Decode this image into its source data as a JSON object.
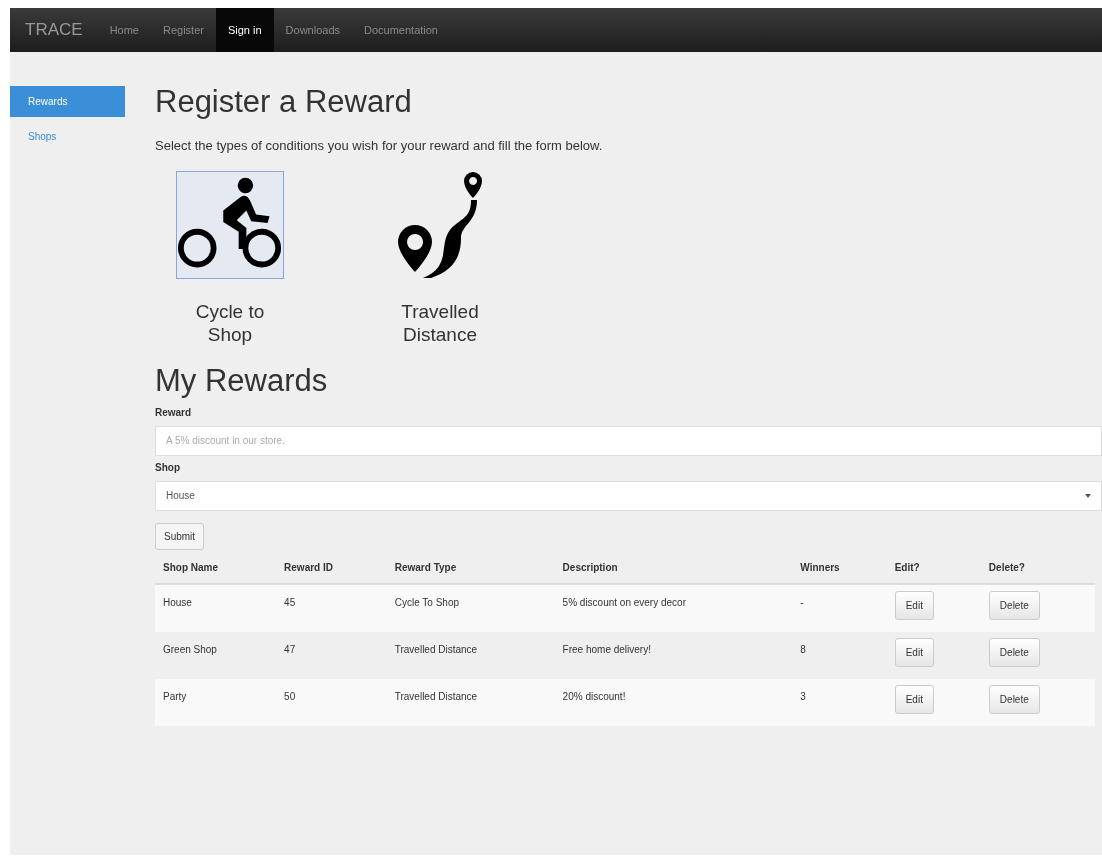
{
  "navbar": {
    "brand": "TRACE",
    "items": [
      {
        "label": "Home",
        "selected": false
      },
      {
        "label": "Register",
        "selected": false
      },
      {
        "label": "Sign in",
        "selected": true
      },
      {
        "label": "Downloads",
        "selected": false
      },
      {
        "label": "Documentation",
        "selected": false
      }
    ]
  },
  "sidebar": {
    "items": [
      {
        "label": "Rewards",
        "selected": true
      },
      {
        "label": "Shops",
        "selected": false
      }
    ]
  },
  "heading": "Register a Reward",
  "intro": "Select the types of conditions you wish for your reward and fill the form below.",
  "conditions": [
    {
      "kind": "cycle",
      "label": "Cycle to Shop",
      "selected": true
    },
    {
      "kind": "distance",
      "label": "Travelled Distance",
      "selected": false
    }
  ],
  "my_rewards": {
    "title": "My Rewards",
    "reward_field": {
      "label": "Reward",
      "placeholder": "A 5% discount in our store."
    },
    "shop_field": {
      "label": "Shop",
      "value": "House"
    },
    "submit": "Submit"
  },
  "table": {
    "columns": [
      "Shop Name",
      "Reward ID",
      "Reward Type",
      "Description",
      "Winners",
      "Edit?",
      "Delete?"
    ],
    "rows": [
      {
        "cells": [
          "House",
          "45",
          "Cycle To Shop",
          "5% discount on every decor",
          "-"
        ],
        "edit": "Edit",
        "delete": "Delete"
      },
      {
        "cells": [
          "Green Shop",
          "47",
          "Travelled Distance",
          "Free home delivery!",
          "8"
        ],
        "edit": "Edit",
        "delete": "Delete"
      },
      {
        "cells": [
          "Party",
          "50",
          "Travelled Distance",
          "20% discount!",
          "3"
        ],
        "edit": "Edit",
        "delete": "Delete"
      }
    ]
  }
}
